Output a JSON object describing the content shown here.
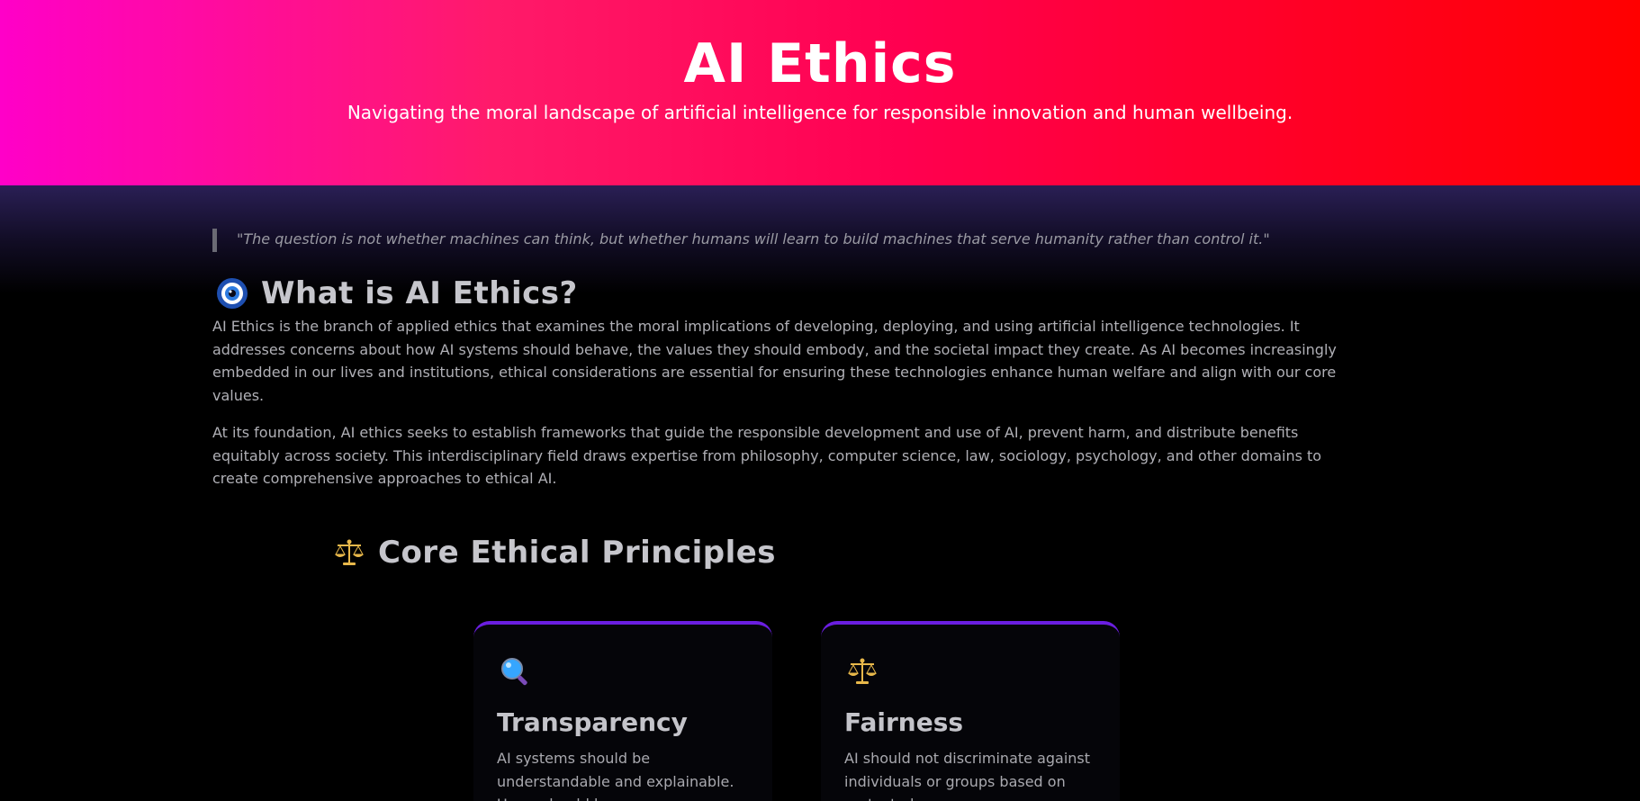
{
  "hero": {
    "title": "AI Ethics",
    "subtitle": "Navigating the moral landscape of artificial intelligence for responsible innovation and human wellbeing."
  },
  "quote": "\"The question is not whether machines can think, but whether humans will learn to build machines that serve humanity rather than control it.\"",
  "intro": {
    "icon": "eye-icon",
    "title": "What is AI Ethics?",
    "paragraphs": [
      "AI Ethics is the branch of applied ethics that examines the moral implications of developing, deploying, and using artificial intelligence technologies. It addresses concerns about how AI systems should behave, the values they should embody, and the societal impact they create. As AI becomes increasingly embedded in our lives and institutions, ethical considerations are essential for ensuring these technologies enhance human welfare and align with our core values.",
      "At its foundation, AI ethics seeks to establish frameworks that guide the responsible development and use of AI, prevent harm, and distribute benefits equitably across society. This interdisciplinary field draws expertise from philosophy, computer science, law, sociology, psychology, and other domains to create comprehensive approaches to ethical AI."
    ]
  },
  "principles": {
    "icon": "scales-icon",
    "title": "Core Ethical Principles",
    "cards": [
      {
        "icon": "magnifier-icon",
        "title": "Transparency",
        "description": "AI systems should be understandable and explainable. Users should know"
      },
      {
        "icon": "scales-icon",
        "title": "Fairness",
        "description": "AI should not discriminate against individuals or groups based on protected"
      }
    ]
  },
  "colors": {
    "hero_start": "#ff00c8",
    "hero_end": "#ff0000",
    "card_accent": "#6a1ee0",
    "background": "#000000"
  }
}
